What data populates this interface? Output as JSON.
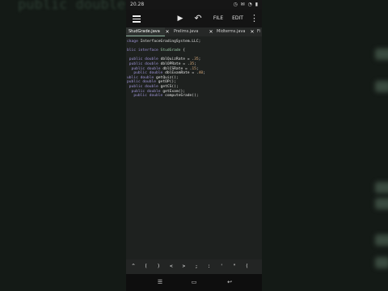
{
  "background": {
    "ghost_text": "public double com"
  },
  "status_bar": {
    "time": "20.28",
    "icons": "◷ ✉ ◔ ▮"
  },
  "toolbar": {
    "file_label": "FILE",
    "edit_label": "EDIT",
    "run_symbol": "▶",
    "undo_symbol": "↶",
    "more_symbol": "⋮"
  },
  "tabs": [
    {
      "label": "StudGrade.java",
      "active": true
    },
    {
      "label": "Prelims.java",
      "active": false
    },
    {
      "label": "Midterms.java",
      "active": false
    },
    {
      "label": "Fi",
      "active": false
    }
  ],
  "tab_close_symbol": "✕",
  "code_lines": [
    "ckage InterfaceGradingSystem.LLC;",
    "",
    "blic interface StudGrade {",
    "",
    " public double dblQuizRate = .35;",
    " public double dblOPRate = .35;",
    "  public double dblCSRate = .15;",
    "   public double dblExamRate = .40;",
    "ublic double getQuiz();",
    "public double getOP();",
    " public double getCS();",
    "  public double getExam();",
    "   public double computeGrade();"
  ],
  "accessory_keys": [
    "^",
    "(",
    ")",
    "<",
    ">",
    ";",
    ":",
    "'",
    "\"",
    "("
  ],
  "nav_buttons": {
    "recents": "☰",
    "home": "▭",
    "back": "↩"
  },
  "colors": {
    "editor_bg": "#1e211f",
    "keyword": "#9f95d8",
    "type": "#9cc8a8",
    "number": "#d7a97a",
    "active_tab_underline": "#8fb3a0"
  }
}
